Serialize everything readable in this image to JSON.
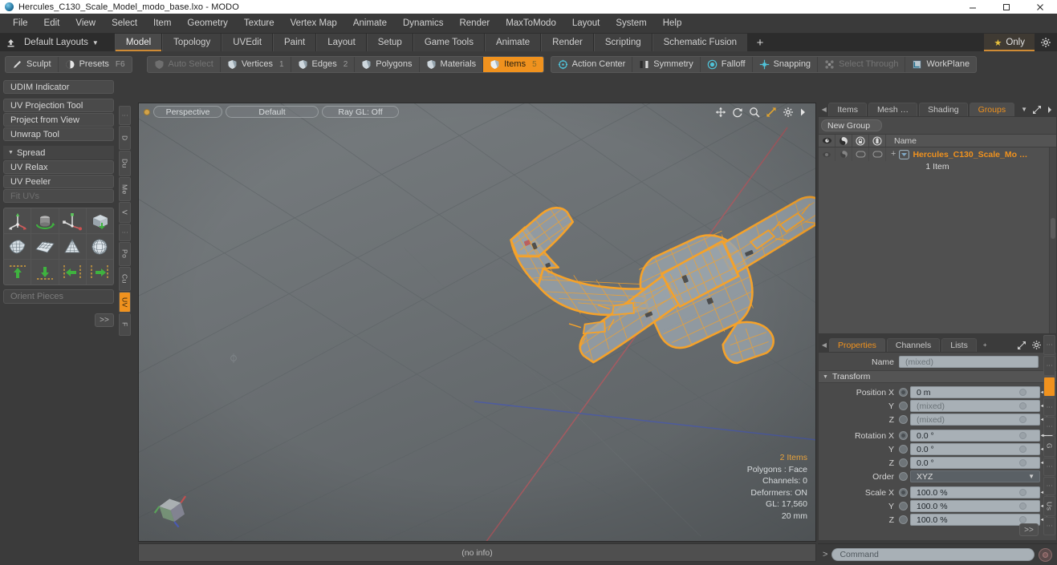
{
  "window": {
    "title": "Hercules_C130_Scale_Model_modo_base.lxo - MODO",
    "app_icon": "modo-orb-icon",
    "minimize": "minimize-icon",
    "maximize": "maximize-icon",
    "close": "close-icon"
  },
  "menubar": {
    "items": [
      "File",
      "Edit",
      "View",
      "Select",
      "Item",
      "Geometry",
      "Texture",
      "Vertex Map",
      "Animate",
      "Dynamics",
      "Render",
      "MaxToModo",
      "Layout",
      "System",
      "Help"
    ]
  },
  "layoutbar": {
    "home_icon": "upload-icon",
    "default_layouts": "Default Layouts",
    "caret": "▼",
    "tabs": [
      {
        "label": "Model",
        "active": true
      },
      {
        "label": "Topology",
        "active": false
      },
      {
        "label": "UVEdit",
        "active": false
      },
      {
        "label": "Paint",
        "active": false
      },
      {
        "label": "Layout",
        "active": false
      },
      {
        "label": "Setup",
        "active": false
      },
      {
        "label": "Game Tools",
        "active": false
      },
      {
        "label": "Animate",
        "active": false
      },
      {
        "label": "Render",
        "active": false
      },
      {
        "label": "Scripting",
        "active": false
      },
      {
        "label": "Schematic Fusion",
        "active": false
      }
    ],
    "add_tab": "+",
    "only_label": "Only",
    "star_icon": "star-icon",
    "gear_icon": "gear-icon"
  },
  "modebar": {
    "left_group": [
      {
        "label": "Sculpt",
        "icon": "sculpt-brush-icon",
        "state": "normal",
        "num": ""
      },
      {
        "label": "Presets",
        "icon": "presets-sphere-icon",
        "state": "normal",
        "num": "F6"
      }
    ],
    "select_group": [
      {
        "label": "Auto Select",
        "icon": "shield-icon",
        "state": "disabled",
        "num": ""
      },
      {
        "label": "Vertices",
        "icon": "shield-icon",
        "state": "normal",
        "num": "1"
      },
      {
        "label": "Edges",
        "icon": "shield-icon",
        "state": "normal",
        "num": "2"
      },
      {
        "label": "Polygons",
        "icon": "shield-icon",
        "state": "normal",
        "num": ""
      },
      {
        "label": "Materials",
        "icon": "shield-icon",
        "state": "normal",
        "num": ""
      },
      {
        "label": "Items",
        "icon": "shield-icon",
        "state": "active",
        "num": "5"
      }
    ],
    "right_group": [
      {
        "label": "Action Center",
        "icon": "action-center-icon",
        "state": "normal",
        "num": ""
      },
      {
        "label": "Symmetry",
        "icon": "symmetry-icon",
        "state": "normal",
        "num": ""
      },
      {
        "label": "Falloff",
        "icon": "falloff-icon",
        "state": "normal",
        "num": ""
      },
      {
        "label": "Snapping",
        "icon": "snapping-icon",
        "state": "normal",
        "num": ""
      },
      {
        "label": "Select Through",
        "icon": "select-through-icon",
        "state": "disabled",
        "num": ""
      },
      {
        "label": "WorkPlane",
        "icon": "workplane-icon",
        "state": "normal",
        "num": ""
      }
    ]
  },
  "leftpanel": {
    "buttons_a": [
      {
        "label": "UDIM Indicator",
        "disabled": false
      }
    ],
    "buttons_b": [
      {
        "label": "UV Projection Tool",
        "disabled": false
      },
      {
        "label": "Project from View",
        "disabled": false
      },
      {
        "label": "Unwrap Tool",
        "disabled": false
      }
    ],
    "spread_header": "Spread",
    "buttons_c": [
      {
        "label": "UV Relax",
        "disabled": false
      },
      {
        "label": "UV Peeler",
        "disabled": false
      },
      {
        "label": "Fit UVs",
        "disabled": true
      }
    ],
    "icon_rows": [
      [
        "move-axis-icon",
        "rotate-cylinder-icon",
        "scale-axis-icon",
        "drop-box-icon"
      ],
      [
        "uv-fit-icon",
        "uv-grid-flat-icon",
        "uv-cone-icon",
        "uv-sphere-icon"
      ],
      [
        "align-up-icon",
        "align-down-icon",
        "align-left-icon",
        "align-right-icon"
      ]
    ],
    "orient_placeholder": "Orient Pieces",
    "more_label": ">>",
    "vtabs": [
      "⋮",
      "D",
      "Du",
      "Me",
      "V",
      "⋮",
      "Po",
      "Cu",
      "UV",
      "F"
    ],
    "vtab_active": "UV"
  },
  "viewport": {
    "dot": "viewport-active-dot",
    "view_mode": "Perspective",
    "shading_preset": "Default",
    "raygl": "Ray GL: Off",
    "icons": [
      "pan-icon",
      "rotate-icon",
      "zoom-icon",
      "fit-icon",
      "gear-icon",
      "chevron-right-icon"
    ],
    "info": {
      "items": "2 Items",
      "polygons": "Polygons : Face",
      "channels": "Channels: 0",
      "deformers": "Deformers: ON",
      "gl": "GL: 17,560",
      "grid": "20 mm"
    },
    "gizmo": "orientation-cube-gizmo",
    "model_name": "Hercules C-130 aircraft wireframe",
    "selection_color": "#f5a22a"
  },
  "statusbar": {
    "text": "(no info)"
  },
  "rightpanel": {
    "top_tabs": [
      {
        "label": "Items",
        "active": false
      },
      {
        "label": "Mesh …",
        "active": false
      },
      {
        "label": "Shading",
        "active": false
      },
      {
        "label": "Groups",
        "active": true
      }
    ],
    "top_tab_caret": "▼",
    "expand_icon": "expand-icon",
    "arrow_icon": "chevron-right-icon",
    "new_group_label": "New Group",
    "list_columns": [
      "eye-icon",
      "render-icon",
      "lock-icon",
      "select-icon",
      "Name"
    ],
    "list_rows": [
      {
        "name": "Hercules_C130_Scale_Mo …",
        "sub": "1 Item",
        "expander": "+",
        "group_icon": "group-icon"
      }
    ],
    "properties": {
      "tabs": [
        {
          "label": "Properties",
          "active": true
        },
        {
          "label": "Channels",
          "active": false
        },
        {
          "label": "Lists",
          "active": false
        }
      ],
      "add_tab": "+",
      "gear_icon": "gear-icon",
      "expand_icon": "expand-icon",
      "name_label": "Name",
      "name_value": "(mixed)",
      "transform_section": "Transform",
      "fields": [
        {
          "label": "Position X",
          "value": "0 m",
          "radio": "filled"
        },
        {
          "label": "Y",
          "value": "(mixed)",
          "radio": "empty"
        },
        {
          "label": "Z",
          "value": "(mixed)",
          "radio": "empty"
        },
        {
          "label": "Rotation X",
          "value": "0.0 °",
          "radio": "filled"
        },
        {
          "label": "Y",
          "value": "0.0 °",
          "radio": "empty"
        },
        {
          "label": "Z",
          "value": "0.0 °",
          "radio": "empty"
        },
        {
          "label": "Order",
          "value": "XYZ",
          "radio": "empty",
          "type": "dropdown"
        },
        {
          "label": "Scale X",
          "value": "100.0 %",
          "radio": "filled"
        },
        {
          "label": "Y",
          "value": "100.0 %",
          "radio": "empty"
        },
        {
          "label": "Z",
          "value": "100.0 %",
          "radio": "empty"
        }
      ],
      "more_label": ">>"
    },
    "vtabs": [
      "⋮",
      "⋮",
      "",
      "⋮",
      "⋮",
      "G",
      "⋮",
      "⋮",
      "Us",
      "⋮"
    ],
    "vtab_active_index": 2
  },
  "command": {
    "prompt": ">",
    "placeholder": "Command",
    "record_icon": "record-icon"
  },
  "colors": {
    "accent": "#f0921e",
    "panel": "#3b3b3b",
    "viewport_bg": "#6b6f72",
    "field": "#a8b0b6"
  }
}
